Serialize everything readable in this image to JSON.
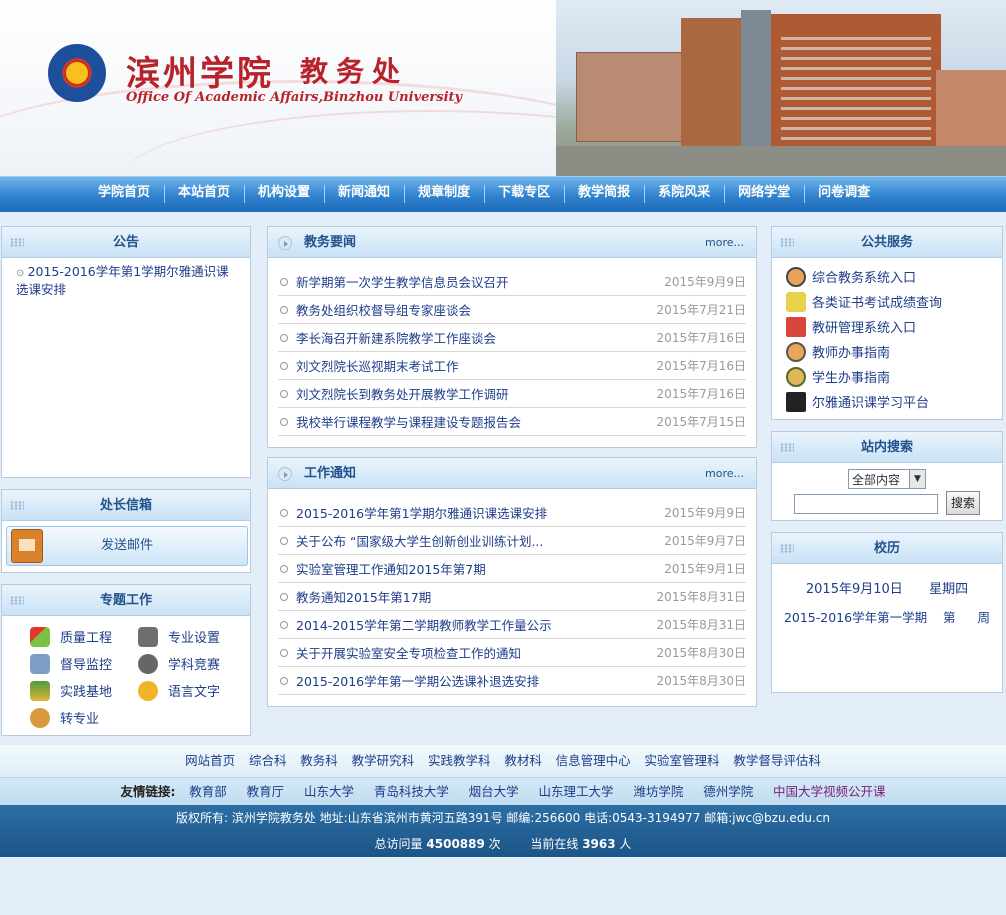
{
  "header": {
    "school_cn": "滨州学院",
    "dept_cn": "教务处",
    "en_title": "Office Of Academic Affairs,Binzhou University"
  },
  "nav": [
    "学院首页",
    "本站首页",
    "机构设置",
    "新闻通知",
    "规章制度",
    "下载专区",
    "教学简报",
    "系院风采",
    "网络学堂",
    "问卷调查"
  ],
  "announcement": {
    "title": "公告",
    "text": "2015-2016学年第1学期尔雅通识课选课安排"
  },
  "director_mail": {
    "title": "处长信箱",
    "button": "发送邮件"
  },
  "topics": {
    "title": "专题工作",
    "items": [
      "质量工程",
      "专业设置",
      "督导监控",
      "学科竞赛",
      "实践基地",
      "语言文字",
      "转专业"
    ]
  },
  "news": {
    "title": "教务要闻",
    "more": "more...",
    "items": [
      {
        "title": "新学期第一次学生教学信息员会议召开",
        "date": "2015年9月9日"
      },
      {
        "title": "教务处组织校督导组专家座谈会",
        "date": "2015年7月21日"
      },
      {
        "title": "李长海召开新建系院教学工作座谈会",
        "date": "2015年7月16日"
      },
      {
        "title": "刘文烈院长巡视期末考试工作",
        "date": "2015年7月16日"
      },
      {
        "title": "刘文烈院长到教务处开展教学工作调研",
        "date": "2015年7月16日"
      },
      {
        "title": "我校举行课程教学与课程建设专题报告会",
        "date": "2015年7月15日"
      }
    ]
  },
  "work": {
    "title": "工作通知",
    "more": "more...",
    "items": [
      {
        "title": "2015-2016学年第1学期尔雅通识课选课安排",
        "date": "2015年9月9日"
      },
      {
        "title": "关于公布 “国家级大学生创新创业训练计划...",
        "date": "2015年9月7日"
      },
      {
        "title": "实验室管理工作通知2015年第7期",
        "date": "2015年9月1日"
      },
      {
        "title": "教务通知2015年第17期",
        "date": "2015年8月31日"
      },
      {
        "title": "2014-2015学年第二学期教师教学工作量公示",
        "date": "2015年8月31日"
      },
      {
        "title": "关于开展实验室安全专项检查工作的通知",
        "date": "2015年8月30日"
      },
      {
        "title": "2015-2016学年第一学期公选课补退选安排",
        "date": "2015年8月30日"
      }
    ]
  },
  "services": {
    "title": "公共服务",
    "items": [
      {
        "label": "综合教务系统入口",
        "icon": "user-icon"
      },
      {
        "label": "各类证书考试成绩查询",
        "icon": "certificate-icon"
      },
      {
        "label": "教研管理系统入口",
        "icon": "house-user-icon"
      },
      {
        "label": "教师办事指南",
        "icon": "teacher-icon"
      },
      {
        "label": "学生办事指南",
        "icon": "student-icon"
      },
      {
        "label": "尔雅通识课学习平台",
        "icon": "erya-logo-icon"
      }
    ]
  },
  "search": {
    "title": "站内搜索",
    "scope": "全部内容",
    "button": "搜索"
  },
  "calendar": {
    "title": "校历",
    "date": "2015年9月10日",
    "weekday": "星期四",
    "term": "2015-2016学年第一学期",
    "week_prefix": "第",
    "week_suffix": "周"
  },
  "footer": {
    "links": [
      "网站首页",
      "综合科",
      "教务科",
      "教学研究科",
      "实践教学科",
      "教材科",
      "信息管理中心",
      "实验室管理科",
      "教学督导评估科"
    ],
    "friend_label": "友情链接:",
    "friends": [
      "教育部",
      "教育厅",
      "山东大学",
      "青岛科技大学",
      "烟台大学",
      "山东理工大学",
      "潍坊学院",
      "德州学院"
    ],
    "friend_highlight": "中国大学视频公开课",
    "copyright": "版权所有: 滨州学院教务处  地址:山东省滨州市黄河五路391号  邮编:256600  电话:0543-3194977  邮箱:jwc@bzu.edu.cn",
    "visits_label": "总访问量",
    "visits": "4500889",
    "visits_unit": "次",
    "online_label": "当前在线",
    "online": "3963",
    "online_unit": "人"
  },
  "colors": {
    "nav_blue": "#2f82cf",
    "title_red": "#b8222a",
    "link_blue": "#1e3d8a",
    "footer_blue": "#1c5486"
  }
}
